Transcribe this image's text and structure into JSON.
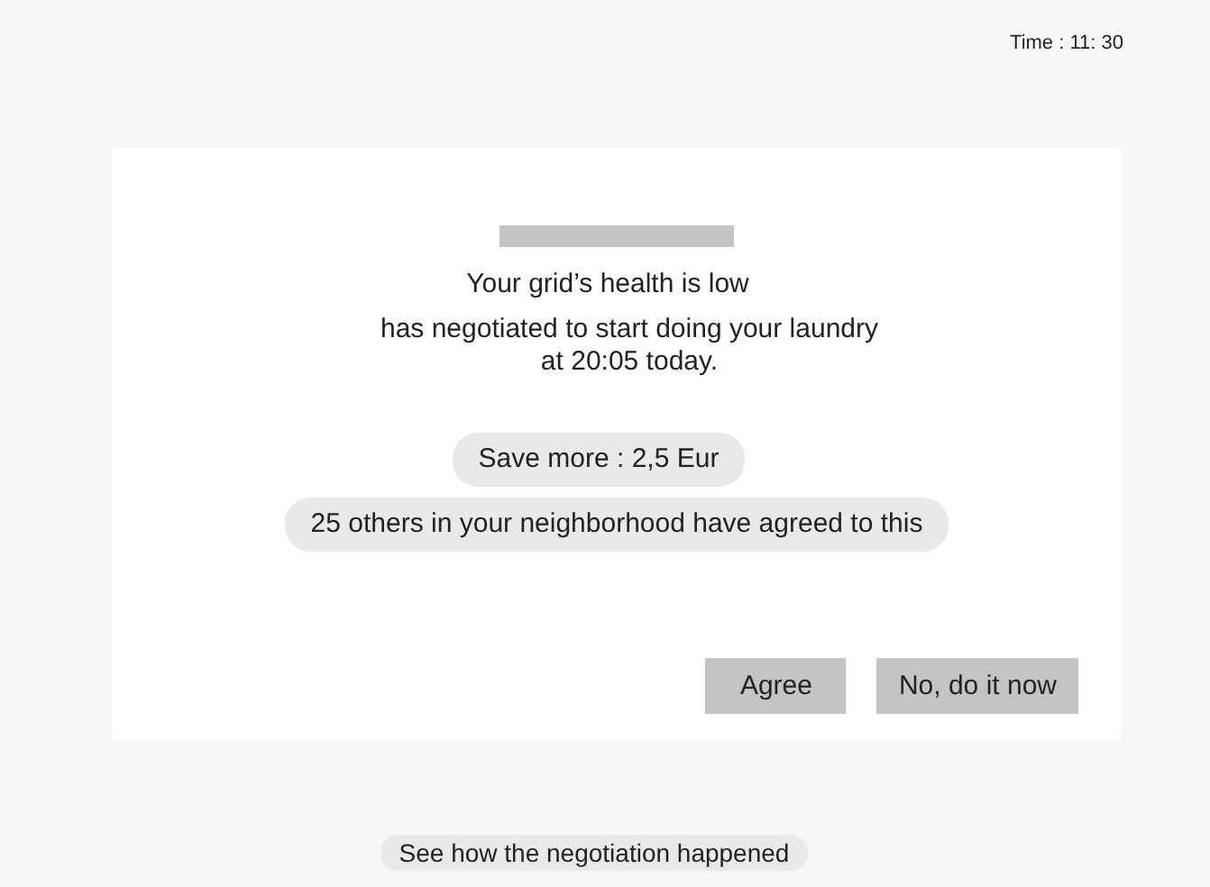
{
  "status": {
    "time": "Time : 11: 30"
  },
  "dialog": {
    "title": "Your grid’s health is low",
    "message": "has negotiated to start doing your laundry\nat 20:05 today.",
    "chips": [
      "Save more : 2,5 Eur",
      "25 others in your neighborhood have agreed to this"
    ],
    "buttons": [
      "Agree",
      "No, do it now"
    ]
  },
  "footer_link": "See how the negotiation happened"
}
